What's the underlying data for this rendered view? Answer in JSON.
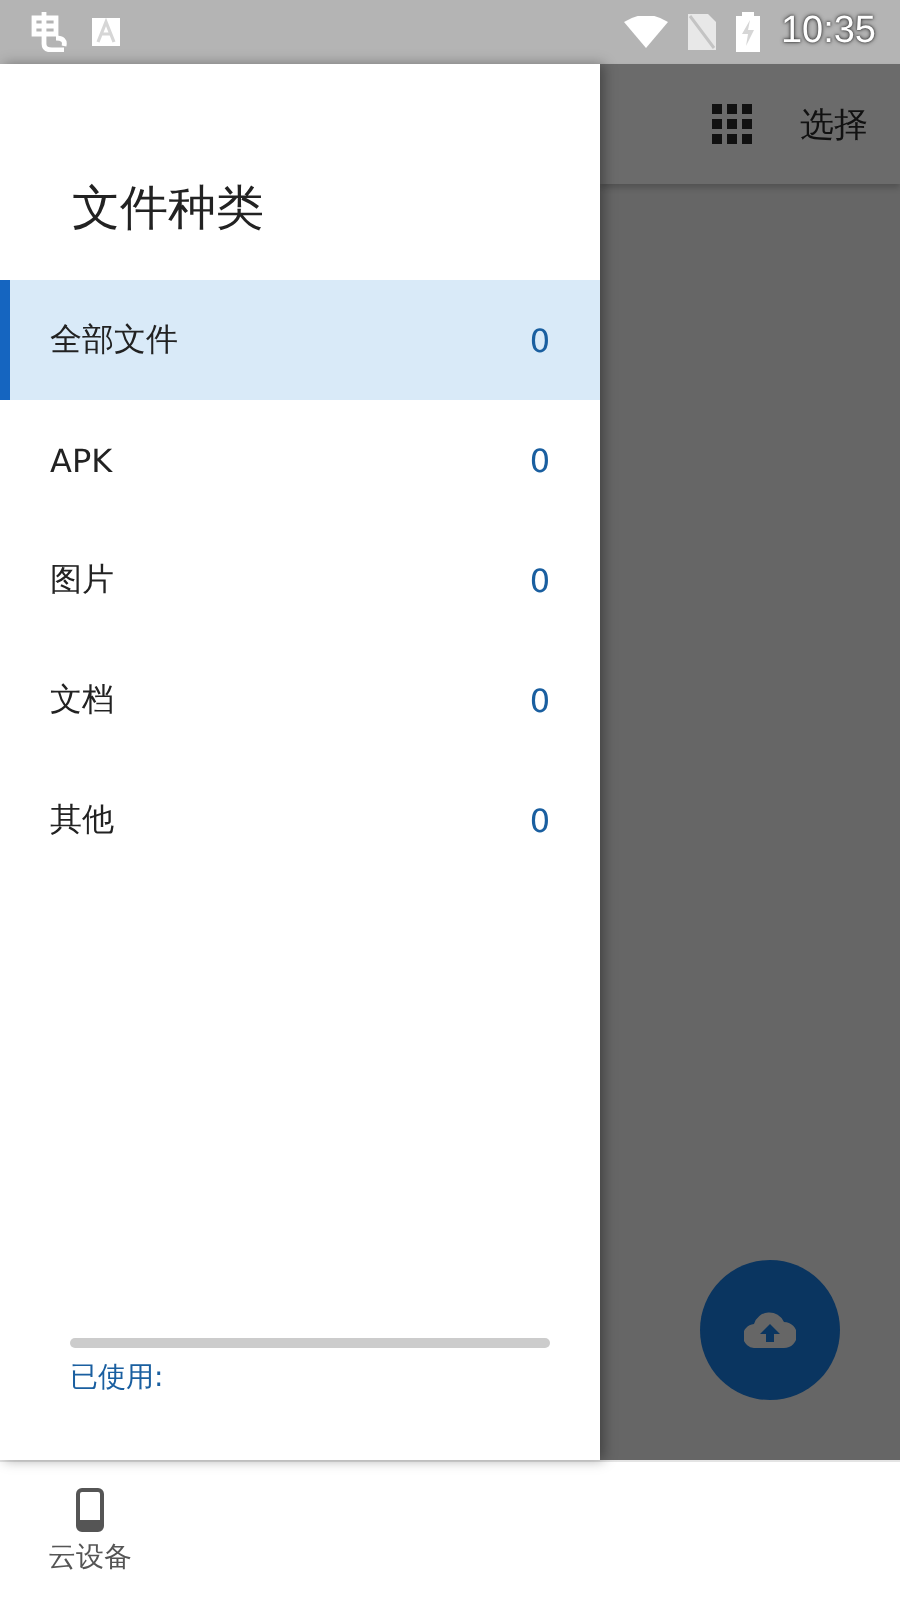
{
  "status_bar": {
    "time": "10:35"
  },
  "toolbar": {
    "select_label": "选择"
  },
  "drawer": {
    "title": "文件种类",
    "items": [
      {
        "label": "全部文件",
        "count": "0",
        "selected": true
      },
      {
        "label": "APK",
        "count": "0",
        "selected": false
      },
      {
        "label": "图片",
        "count": "0",
        "selected": false
      },
      {
        "label": "文档",
        "count": "0",
        "selected": false
      },
      {
        "label": "其他",
        "count": "0",
        "selected": false
      }
    ],
    "storage": {
      "label": "已使用:"
    }
  },
  "bottom_nav": {
    "tabs": [
      {
        "label": "云设备",
        "selected": false
      }
    ]
  }
}
